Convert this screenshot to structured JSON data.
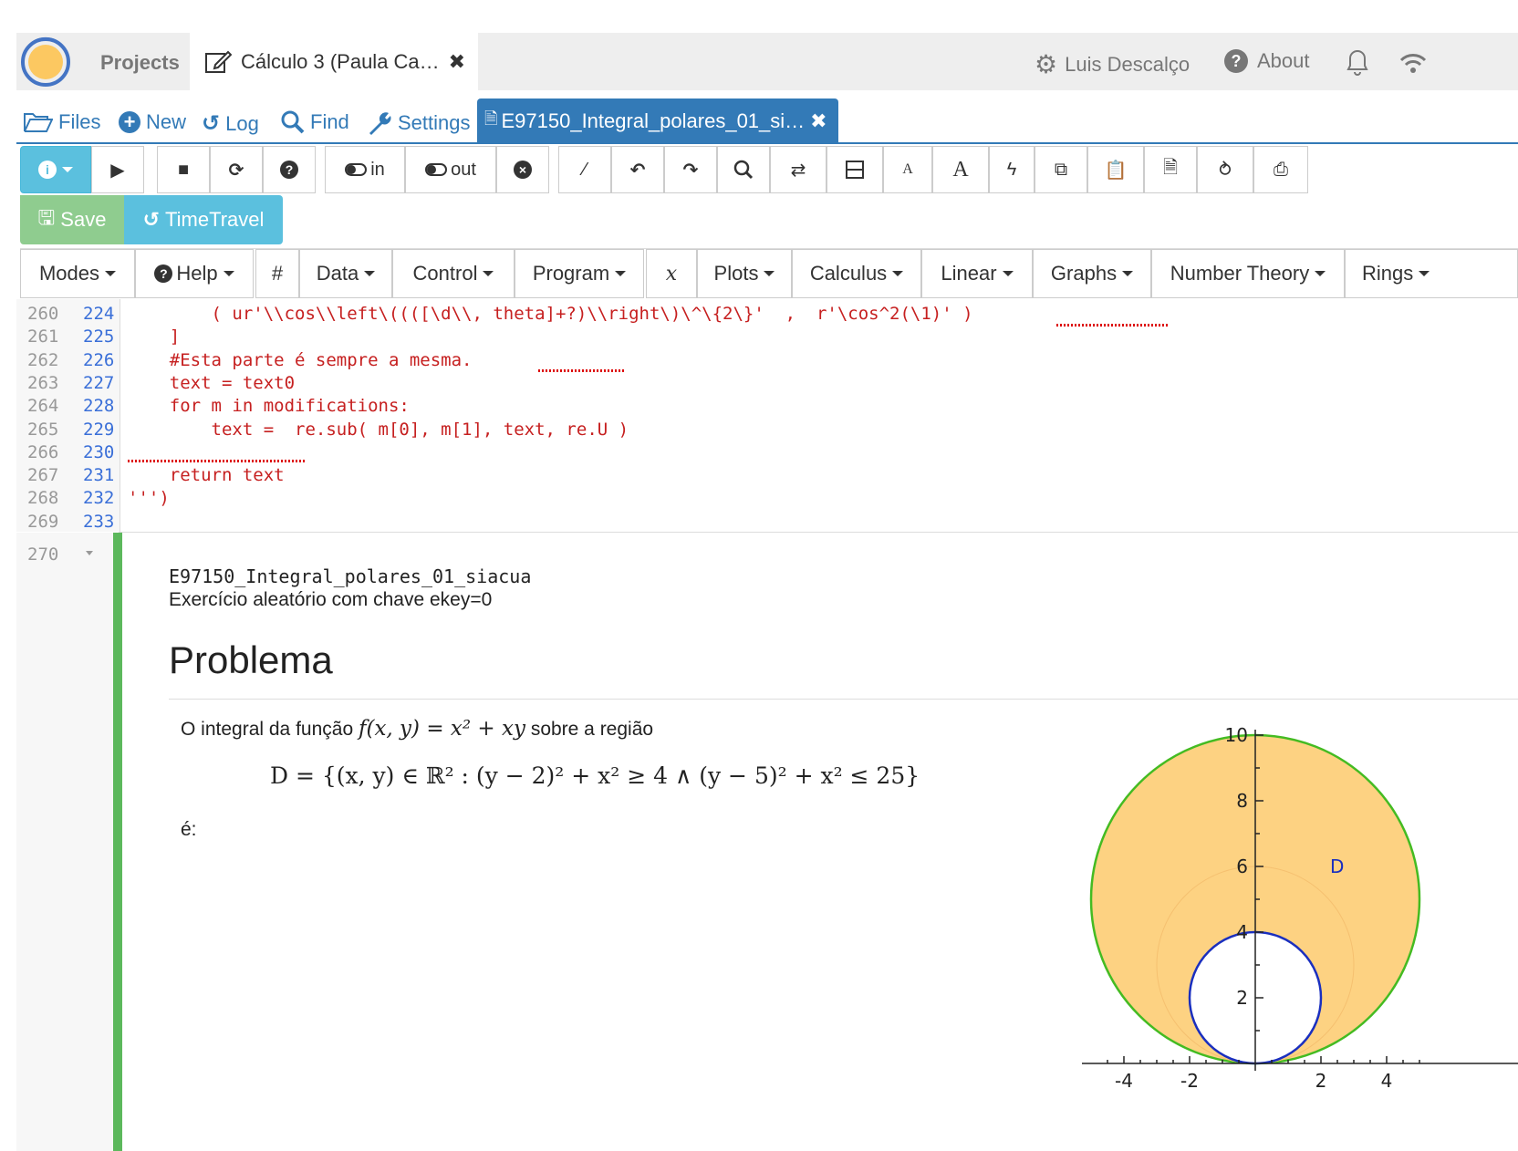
{
  "topbar": {
    "projects_label": "Projects",
    "project_tab_label": "Cálculo 3 (Paula Ca…",
    "user_name": "Luis Descalço",
    "about_label": "About"
  },
  "filebar": {
    "files_label": "Files",
    "new_label": "New",
    "log_label": "Log",
    "find_label": "Find",
    "settings_label": "Settings",
    "file_tab_label": "E97150_Integral_polares_01_si…"
  },
  "toolbar": {
    "kernel_in_label": "in",
    "kernel_out_label": "out",
    "save_label": "Save",
    "timetravel_label": "TimeTravel"
  },
  "menubar": {
    "items": [
      "Modes",
      "Help",
      "#",
      "Data",
      "Control",
      "Program",
      "x",
      "Plots",
      "Calculus",
      "Linear",
      "Graphs",
      "Number Theory",
      "Rings"
    ]
  },
  "code": {
    "lines": [
      {
        "a": "260",
        "b": "224",
        "text": "        ( ur'\\\\cos\\\\left\\((([\\d\\\\, theta]+?)\\\\right\\)\\^\\{2\\}'  ,  r'\\cos^2(\\1)' )"
      },
      {
        "a": "261",
        "b": "225",
        "text": "    ]"
      },
      {
        "a": "262",
        "b": "226",
        "text": "    #Esta parte é sempre a mesma."
      },
      {
        "a": "263",
        "b": "227",
        "text": "    text = text0"
      },
      {
        "a": "264",
        "b": "228",
        "text": "    for m in modifications:"
      },
      {
        "a": "265",
        "b": "229",
        "text": "        text =  re.sub( m[0], m[1], text, re.U )"
      },
      {
        "a": "266",
        "b": "230",
        "text": ""
      },
      {
        "a": "267",
        "b": "231",
        "text": "    return text"
      },
      {
        "a": "268",
        "b": "232",
        "text": "''')"
      },
      {
        "a": "269",
        "b": "233",
        "text": ""
      }
    ]
  },
  "output": {
    "line_number": "270",
    "name": "E97150_Integral_polares_01_siacua",
    "key_text": "Exercício aleatório com chave ekey=0",
    "heading": "Problema",
    "intro_text": "O integral da função",
    "func": "f(x, y) = x² + xy",
    "intro_text2": "sobre a região",
    "region": "D = {(x, y) ∈ ℝ² : (y − 2)² + x² ≥ 4 ∧ (y − 5)² + x² ≤ 25}",
    "tail_text": "é:"
  },
  "plot": {
    "region_label": "D",
    "y_ticks": [
      "2",
      "4",
      "6",
      "8",
      "10"
    ],
    "x_ticks": [
      "-4",
      "-2",
      "2",
      "4"
    ],
    "outer_color": "#44bb22",
    "inner_color": "#1a2fbf",
    "fill_color": "#fdd282"
  }
}
